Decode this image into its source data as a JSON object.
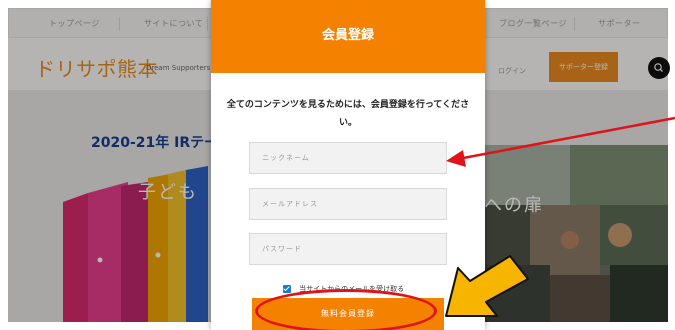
{
  "top_nav": {
    "items": [
      {
        "label": "トップページ"
      },
      {
        "label": "サイトについて"
      },
      {
        "label": "ブログ一覧ページ"
      },
      {
        "label": "サポーター"
      }
    ]
  },
  "header": {
    "logo": "ドリサポ熊本",
    "logo_sub": "Dream Supporters",
    "login": "ログイン",
    "supporter_button": "サポーター登録",
    "search_icon": "search-icon"
  },
  "hero": {
    "title": "2020-21年 IRテー",
    "big_text_left": "子ども",
    "big_text_right": "への扉"
  },
  "modal": {
    "title": "会員登録",
    "description": "全てのコンテンツを見るためには、会員登録を行ってください。",
    "fields": {
      "nickname_placeholder": "ニックネーム",
      "email_placeholder": "メールアドレス",
      "password_placeholder": "パスワード"
    },
    "checkbox_label": "当サイトからのメールを受け取る",
    "checkbox_checked": true,
    "submit_label": "無料会員登録"
  },
  "colors": {
    "accent": "#f48200",
    "annotation_red": "#e0131a",
    "annotation_yellow": "#f7b500"
  }
}
